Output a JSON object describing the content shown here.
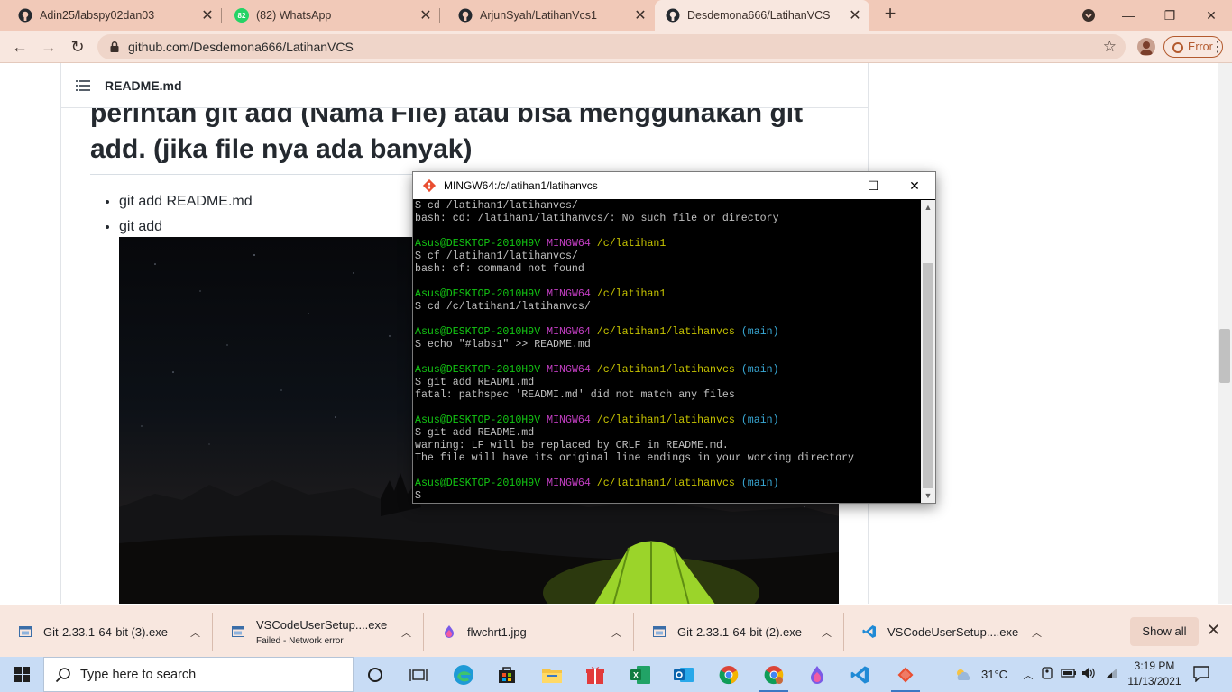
{
  "browser": {
    "tabs": [
      {
        "title": "Adin25/labspy02dan03",
        "icon": "github-icon"
      },
      {
        "title": "(82) WhatsApp",
        "icon": "whatsapp-icon",
        "badge": "82"
      },
      {
        "title": "ArjunSyah/LatihanVcs1",
        "icon": "github-icon"
      },
      {
        "title": "Desdemona666/LatihanVCS",
        "icon": "github-icon",
        "active": true
      }
    ],
    "url": "github.com/Desdemona666/LatihanVCS",
    "error_label": "Error"
  },
  "readme": {
    "file_name": "README.md",
    "heading_line1": "perintah git add (Nama File) atau bisa menggunakan git",
    "heading_line2": "add. (jika file nya ada banyak)",
    "bullets": [
      "git add README.md",
      "git add"
    ]
  },
  "terminal": {
    "title": "MINGW64:/c/latihan1/latihanvcs",
    "lines": [
      {
        "type": "out",
        "text": "$ cd /latihan1/latihanvcs/"
      },
      {
        "type": "out",
        "text": "bash: cd: /latihan1/latihanvcs/: No such file or directory"
      },
      {
        "type": "blank"
      },
      {
        "type": "prompt",
        "user": "Asus@DESKTOP-2010H9V",
        "sys": "MINGW64",
        "path": "/c/latihan1",
        "branch": ""
      },
      {
        "type": "out",
        "text": "$ cf /latihan1/latihanvcs/"
      },
      {
        "type": "out",
        "text": "bash: cf: command not found"
      },
      {
        "type": "blank"
      },
      {
        "type": "prompt",
        "user": "Asus@DESKTOP-2010H9V",
        "sys": "MINGW64",
        "path": "/c/latihan1",
        "branch": ""
      },
      {
        "type": "out",
        "text": "$ cd /c/latihan1/latihanvcs/"
      },
      {
        "type": "blank"
      },
      {
        "type": "prompt",
        "user": "Asus@DESKTOP-2010H9V",
        "sys": "MINGW64",
        "path": "/c/latihan1/latihanvcs",
        "branch": "(main)"
      },
      {
        "type": "out",
        "text": "$ echo \"#labs1\" >> README.md"
      },
      {
        "type": "blank"
      },
      {
        "type": "prompt",
        "user": "Asus@DESKTOP-2010H9V",
        "sys": "MINGW64",
        "path": "/c/latihan1/latihanvcs",
        "branch": "(main)"
      },
      {
        "type": "out",
        "text": "$ git add READMI.md"
      },
      {
        "type": "out",
        "text": "fatal: pathspec 'READMI.md' did not match any files"
      },
      {
        "type": "blank"
      },
      {
        "type": "prompt",
        "user": "Asus@DESKTOP-2010H9V",
        "sys": "MINGW64",
        "path": "/c/latihan1/latihanvcs",
        "branch": "(main)"
      },
      {
        "type": "out",
        "text": "$ git add README.md"
      },
      {
        "type": "out",
        "text": "warning: LF will be replaced by CRLF in README.md."
      },
      {
        "type": "out",
        "text": "The file will have its original line endings in your working directory"
      },
      {
        "type": "blank"
      },
      {
        "type": "prompt",
        "user": "Asus@DESKTOP-2010H9V",
        "sys": "MINGW64",
        "path": "/c/latihan1/latihanvcs",
        "branch": "(main)"
      },
      {
        "type": "out",
        "text": "$"
      }
    ]
  },
  "downloads": {
    "items": [
      {
        "name": "Git-2.33.1-64-bit (3).exe",
        "status": "",
        "icon": "installer-icon"
      },
      {
        "name": "VSCodeUserSetup....exe",
        "status": "Failed - Network error",
        "icon": "installer-icon"
      },
      {
        "name": "flwchrt1.jpg",
        "status": "",
        "icon": "image-file-icon"
      },
      {
        "name": "Git-2.33.1-64-bit (2).exe",
        "status": "",
        "icon": "installer-icon"
      },
      {
        "name": "VSCodeUserSetup....exe",
        "status": "",
        "icon": "vscode-icon"
      }
    ],
    "show_all": "Show all"
  },
  "taskbar": {
    "search_placeholder": "Type here to search",
    "temperature": "31°C",
    "time": "3:19 PM",
    "date": "11/13/2021"
  },
  "colors": {
    "chrome_accent": "#f1c9b8",
    "prompt_user": "#13c613",
    "prompt_system": "#c33ec3",
    "prompt_path": "#c7c400",
    "prompt_branch": "#39a9d6",
    "error": "#b35a2e"
  }
}
